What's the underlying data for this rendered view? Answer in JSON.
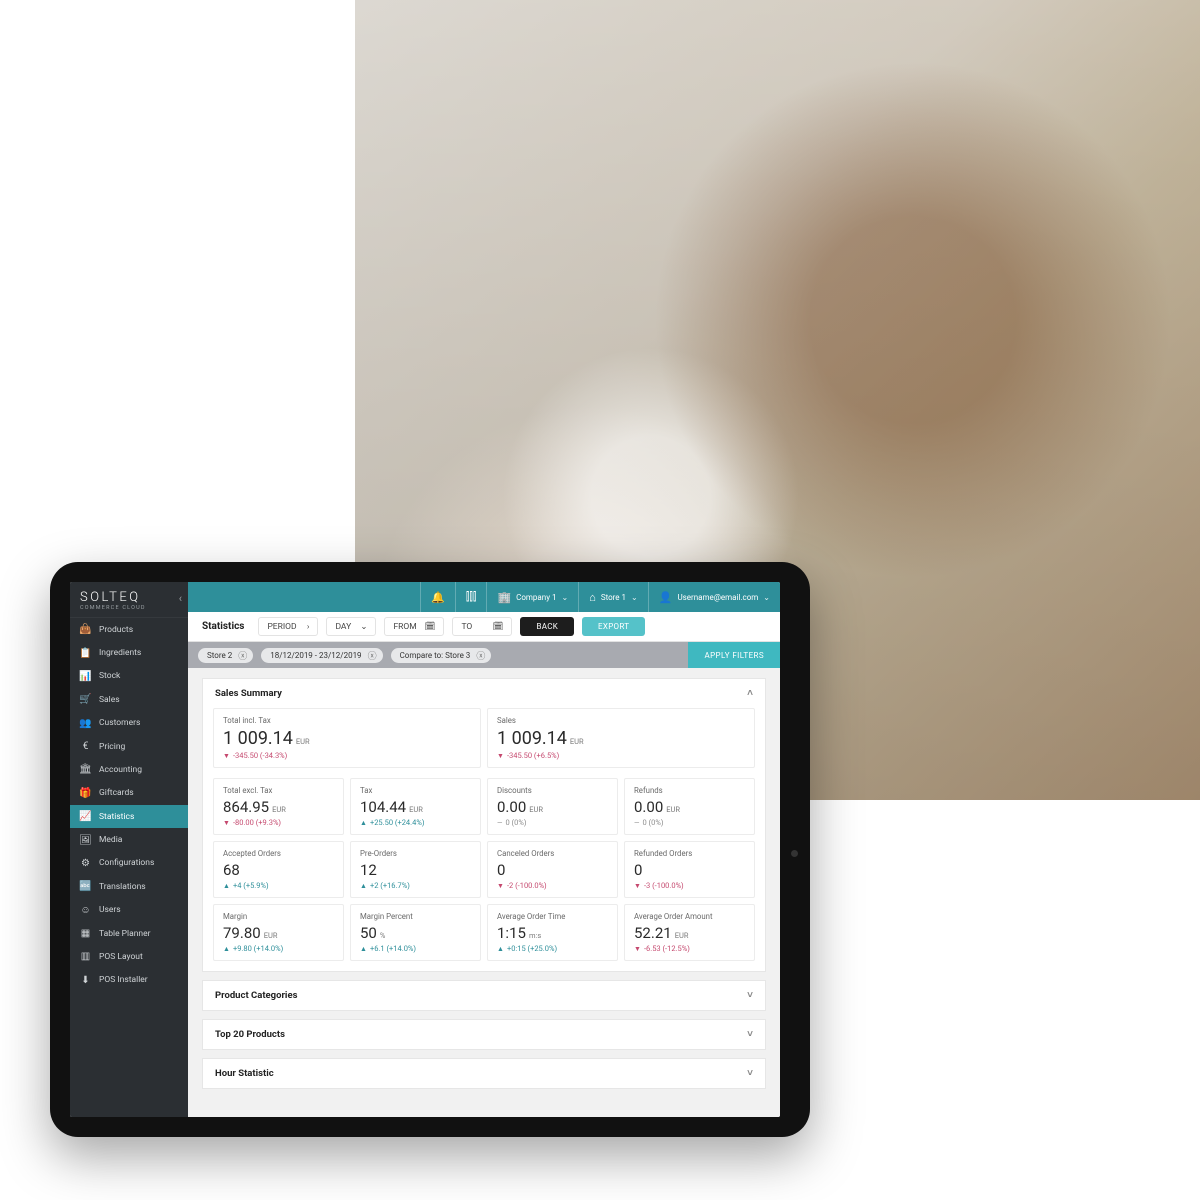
{
  "brand": {
    "title": "SOLTEQ",
    "subtitle": "COMMERCE CLOUD"
  },
  "topbar": {
    "company": "Company 1",
    "store": "Store 1",
    "user": "Username@email.com"
  },
  "sidebar": {
    "items": [
      {
        "icon": "bag-icon",
        "label": "Products"
      },
      {
        "icon": "ingredients-icon",
        "label": "Ingredients"
      },
      {
        "icon": "stock-icon",
        "label": "Stock"
      },
      {
        "icon": "cart-icon",
        "label": "Sales"
      },
      {
        "icon": "customers-icon",
        "label": "Customers"
      },
      {
        "icon": "pricing-icon",
        "label": "Pricing"
      },
      {
        "icon": "accounting-icon",
        "label": "Accounting"
      },
      {
        "icon": "giftcards-icon",
        "label": "Giftcards"
      },
      {
        "icon": "statistics-icon",
        "label": "Statistics",
        "active": true
      },
      {
        "icon": "media-icon",
        "label": "Media"
      },
      {
        "icon": "configurations-icon",
        "label": "Configurations"
      },
      {
        "icon": "translations-icon",
        "label": "Translations"
      },
      {
        "icon": "users-icon",
        "label": "Users"
      },
      {
        "icon": "tableplanner-icon",
        "label": "Table Planner"
      },
      {
        "icon": "poslayout-icon",
        "label": "POS Layout"
      },
      {
        "icon": "posinstaller-icon",
        "label": "POS Installer"
      }
    ]
  },
  "toolbar": {
    "title": "Statistics",
    "period_label": "PERIOD",
    "day_label": "DAY",
    "from_label": "FROM",
    "to_label": "TO",
    "back": "BACK",
    "export": "EXPORT"
  },
  "chips": {
    "items": [
      {
        "label": "Store 2"
      },
      {
        "label": "18/12/2019 - 23/12/2019"
      },
      {
        "label": "Compare to: Store 3"
      }
    ],
    "apply": "APPLY FILTERS"
  },
  "summary": {
    "title": "Sales Summary",
    "big": [
      {
        "label": "Total incl. Tax",
        "value": "1 009.14",
        "unit": "EUR",
        "delta": "-345.50 (-34.3%)",
        "dir": "down"
      },
      {
        "label": "Sales",
        "value": "1 009.14",
        "unit": "EUR",
        "delta": "-345.50 (+6.5%)",
        "dir": "down"
      }
    ],
    "cards": [
      {
        "label": "Total excl. Tax",
        "value": "864.95",
        "unit": "EUR",
        "delta": "-80.00 (+9.3%)",
        "dir": "down"
      },
      {
        "label": "Tax",
        "value": "104.44",
        "unit": "EUR",
        "delta": "+25.50 (+24.4%)",
        "dir": "up"
      },
      {
        "label": "Discounts",
        "value": "0.00",
        "unit": "EUR",
        "delta": "0 (0%)",
        "dir": "flat"
      },
      {
        "label": "Refunds",
        "value": "0.00",
        "unit": "EUR",
        "delta": "0 (0%)",
        "dir": "flat"
      },
      {
        "label": "Accepted Orders",
        "value": "68",
        "unit": "",
        "delta": "+4 (+5.9%)",
        "dir": "up"
      },
      {
        "label": "Pre-Orders",
        "value": "12",
        "unit": "",
        "delta": "+2 (+16.7%)",
        "dir": "up"
      },
      {
        "label": "Canceled Orders",
        "value": "0",
        "unit": "",
        "delta": "-2 (-100.0%)",
        "dir": "down"
      },
      {
        "label": "Refunded Orders",
        "value": "0",
        "unit": "",
        "delta": "-3 (-100.0%)",
        "dir": "down"
      },
      {
        "label": "Margin",
        "value": "79.80",
        "unit": "EUR",
        "delta": "+9.80 (+14.0%)",
        "dir": "up"
      },
      {
        "label": "Margin Percent",
        "value": "50",
        "unit": "%",
        "delta": "+6.1 (+14.0%)",
        "dir": "up"
      },
      {
        "label": "Average  Order Time",
        "value": "1:15",
        "unit": "m:s",
        "delta": "+0:15 (+25.0%)",
        "dir": "up"
      },
      {
        "label": "Average Order Amount",
        "value": "52.21",
        "unit": "EUR",
        "delta": "-6.53 (-12.5%)",
        "dir": "down"
      }
    ]
  },
  "panels": [
    {
      "title": "Product Categories"
    },
    {
      "title": "Top 20 Products"
    },
    {
      "title": "Hour Statistic"
    }
  ],
  "icons": {
    "bag-icon": "👜",
    "ingredients-icon": "📋",
    "stock-icon": "📊",
    "cart-icon": "🛒",
    "customers-icon": "👥",
    "pricing-icon": "€",
    "accounting-icon": "🏛",
    "giftcards-icon": "🎁",
    "statistics-icon": "📈",
    "media-icon": "🖼",
    "configurations-icon": "⚙",
    "translations-icon": "🔤",
    "users-icon": "☺",
    "tableplanner-icon": "▦",
    "poslayout-icon": "▥",
    "posinstaller-icon": "⬇"
  }
}
